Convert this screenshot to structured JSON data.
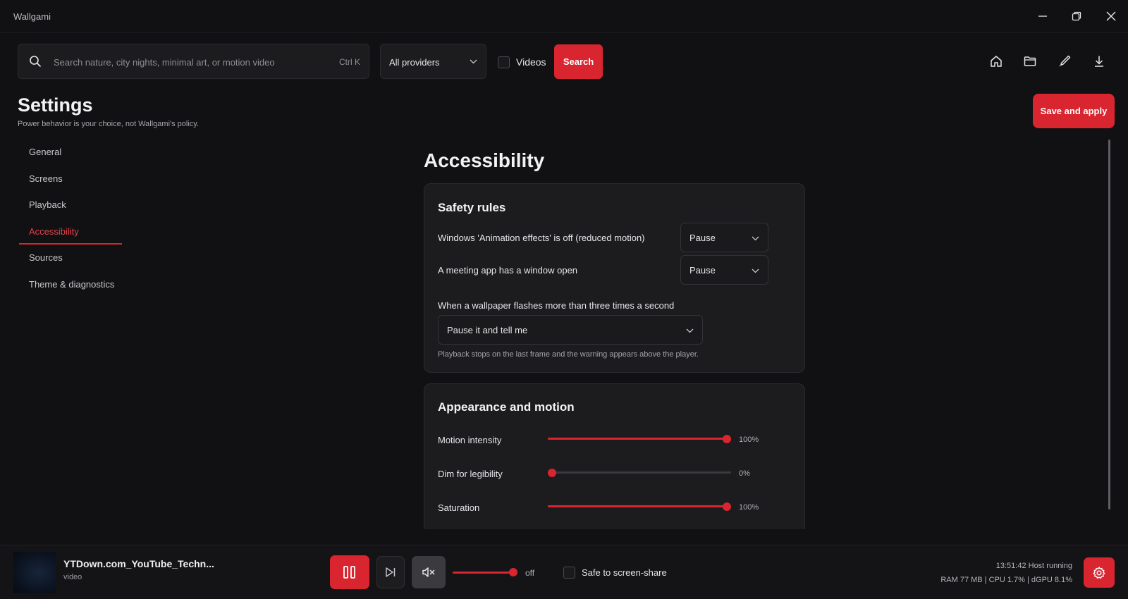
{
  "window": {
    "title": "Wallgami",
    "controls": [
      "minimize-icon",
      "restore-icon",
      "close-icon"
    ]
  },
  "search": {
    "placeholder": "Search nature, city nights, minimal art, or motion video",
    "shortcut": "Ctrl K",
    "provider": "All providers",
    "videos_label": "Videos",
    "videos_checked": false,
    "button": "Search"
  },
  "toolbar": {
    "icons": [
      "home-icon",
      "folder-icon",
      "brush-icon",
      "download-icon"
    ]
  },
  "settings": {
    "title": "Settings",
    "subtitle": "Power behavior is your choice, not Wallgami's policy.",
    "save_label": "Save and apply"
  },
  "nav": {
    "items": [
      {
        "label": "General",
        "active": false
      },
      {
        "label": "Screens",
        "active": false
      },
      {
        "label": "Playback",
        "active": false
      },
      {
        "label": "Accessibility",
        "active": true
      },
      {
        "label": "Sources",
        "active": false
      },
      {
        "label": "Theme & diagnostics",
        "active": false
      }
    ]
  },
  "main": {
    "section_title": "Accessibility",
    "safety": {
      "title": "Safety rules",
      "rules": [
        {
          "label": "Windows 'Animation effects' is off (reduced motion)",
          "value": "Pause"
        },
        {
          "label": "A meeting app has a window open",
          "value": "Pause"
        }
      ],
      "flash_label": "When a wallpaper flashes more than three times a second",
      "flash_value": "Pause it and tell me",
      "flash_hint": "Playback stops on the last frame and the warning appears above the player."
    },
    "appearance": {
      "title": "Appearance and motion",
      "sliders": [
        {
          "label": "Motion intensity",
          "value": 100,
          "display": "100%"
        },
        {
          "label": "Dim for legibility",
          "value": 0,
          "display": "0%"
        },
        {
          "label": "Saturation",
          "value": 100,
          "display": "100%"
        }
      ]
    }
  },
  "player": {
    "title": "YTDown.com_YouTube_Techn...",
    "type": "video",
    "volume_label": "off",
    "volume_value": 100,
    "share_label": "Safe to screen-share",
    "share_checked": false,
    "status_line1": "13:51:42   Host running",
    "status_line2": "RAM 77 MB | CPU 1.7% | dGPU 8.1%"
  },
  "colors": {
    "accent": "#d9252f",
    "background": "#111113",
    "card": "#1c1b1e"
  }
}
